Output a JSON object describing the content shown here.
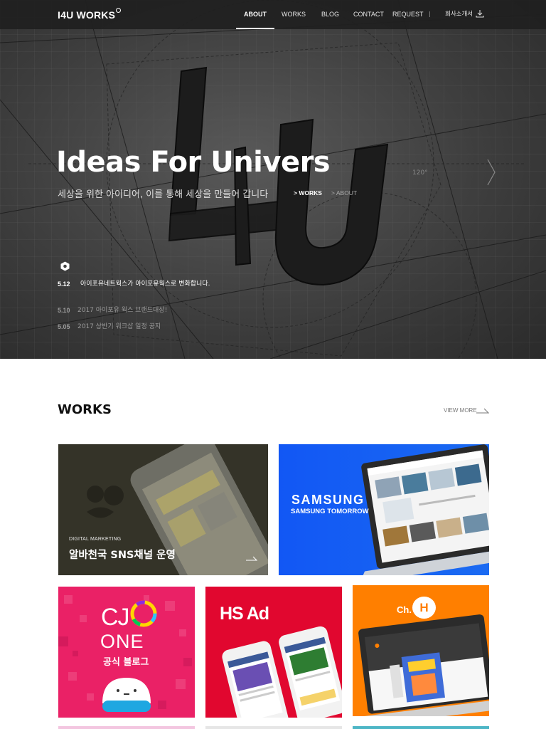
{
  "header": {
    "logo": "I4U WORKS",
    "nav": [
      {
        "label": "ABOUT",
        "active": true
      },
      {
        "label": "WORKS",
        "active": false
      },
      {
        "label": "BLOG",
        "active": false
      },
      {
        "label": "CONTACT",
        "active": false
      },
      {
        "label": "REQUEST",
        "active": false
      }
    ],
    "brochure_label": "회사소개서",
    "brochure_icon": "download-icon"
  },
  "hero": {
    "title": "Ideas For Univers",
    "subtitle": "세상을 위한 아이디어, 이를 통해 세상을 만들어 갑니다",
    "links": [
      {
        "label": "> WORKS",
        "active": true
      },
      {
        "label": "> ABOUT",
        "active": false
      }
    ],
    "news_icon": "hexagon-icon",
    "news": [
      {
        "date": "5.12",
        "text": "아이포유네트웍스가 아이포유웍스로 변화합니다.",
        "active": true
      },
      {
        "date": "5.10",
        "text": "2017 아이포유 웍스 브랜드대상!",
        "active": false
      },
      {
        "date": "5.05",
        "text": "2017 상반기 워크샵 일정 공지",
        "active": false
      }
    ]
  },
  "works": {
    "title": "WORKS",
    "view_more": "VIEW MORE",
    "cards": [
      {
        "category": "DIGITAL MARKETING",
        "title": "알바천국 SNS채널 운영",
        "bg": "#343328"
      },
      {
        "brand": "SAMSUNG",
        "subtitle": "SAMSUNG TOMORROW",
        "bg": "#1a62f3"
      },
      {
        "brand_top": "CJ",
        "brand_bottom": "ONE",
        "subtitle": "공식 블로그",
        "bg": "#ea2166"
      },
      {
        "brand": "HS Ad",
        "bg": "#e1072f"
      },
      {
        "brand_prefix": "Ch.",
        "brand_letter": "H",
        "bg": "#ff7f00"
      }
    ]
  },
  "colors": {
    "hero_dark": "#3e3e3e",
    "topbar": "#202020",
    "text_dark": "#111111"
  }
}
